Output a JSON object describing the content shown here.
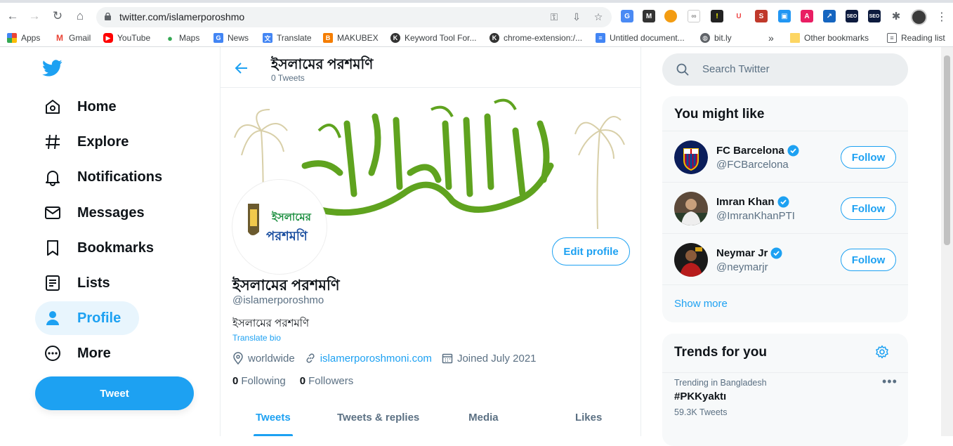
{
  "browser": {
    "url": "twitter.com/islamerporoshmo",
    "bookmarks": [
      {
        "label": "Apps",
        "icon": "apps-icon"
      },
      {
        "label": "Gmail",
        "icon": "gmail-icon"
      },
      {
        "label": "YouTube",
        "icon": "youtube-icon"
      },
      {
        "label": "Maps",
        "icon": "maps-icon"
      },
      {
        "label": "News",
        "icon": "news-icon"
      },
      {
        "label": "Translate",
        "icon": "translate-icon"
      },
      {
        "label": "MAKUBEX",
        "icon": "blogger-icon"
      },
      {
        "label": "Keyword Tool For...",
        "icon": "k-icon"
      },
      {
        "label": "chrome-extension:/...",
        "icon": "k-icon"
      },
      {
        "label": "Untitled document...",
        "icon": "docs-icon"
      },
      {
        "label": "bit.ly",
        "icon": "globe-icon"
      }
    ],
    "overflow": "»",
    "other_bookmarks": "Other bookmarks",
    "reading_list": "Reading list"
  },
  "nav": {
    "items": [
      {
        "label": "Home",
        "icon": "home-icon"
      },
      {
        "label": "Explore",
        "icon": "hashtag-icon"
      },
      {
        "label": "Notifications",
        "icon": "bell-icon"
      },
      {
        "label": "Messages",
        "icon": "envelope-icon"
      },
      {
        "label": "Bookmarks",
        "icon": "bookmark-icon"
      },
      {
        "label": "Lists",
        "icon": "list-icon"
      },
      {
        "label": "Profile",
        "icon": "person-icon",
        "active": true
      },
      {
        "label": "More",
        "icon": "more-icon"
      }
    ],
    "tweet_label": "Tweet"
  },
  "profile": {
    "header_name": "ইসলামের পরশমণি",
    "header_count": "0 Tweets",
    "name": "ইসলামের পরশমণি",
    "handle": "@islamerporoshmo",
    "bio": "ইসলামের পরশমণি",
    "translate": "Translate bio",
    "location": "worldwide",
    "website": "islamerporoshmoni.com",
    "joined": "Joined July 2021",
    "following_count": "0",
    "following_label": "Following",
    "followers_count": "0",
    "followers_label": "Followers",
    "edit_label": "Edit profile",
    "avatar_text_top": "ইসলামের",
    "avatar_text_bottom": "পরশমণি",
    "tabs": [
      "Tweets",
      "Tweets & replies",
      "Media",
      "Likes"
    ]
  },
  "search": {
    "placeholder": "Search Twitter"
  },
  "who_to_follow": {
    "title": "You might like",
    "follow_label": "Follow",
    "items": [
      {
        "name": "FC Barcelona",
        "handle": "@FCBarcelona"
      },
      {
        "name": "Imran Khan",
        "handle": "@ImranKhanPTI"
      },
      {
        "name": "Neymar Jr",
        "handle": "@neymarjr"
      }
    ],
    "show_more": "Show more"
  },
  "trends": {
    "title": "Trends for you",
    "items": [
      {
        "context": "Trending in Bangladesh",
        "topic": "#PKKyaktı",
        "count": "59.3K Tweets"
      }
    ]
  },
  "colors": {
    "accent": "#1da1f2",
    "text": "#0f1419",
    "muted": "#5b7083"
  }
}
